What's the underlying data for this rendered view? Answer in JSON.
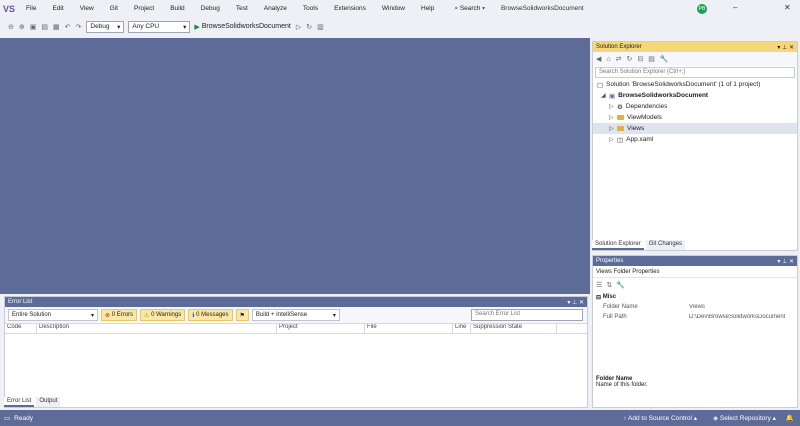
{
  "menubar": {
    "logo": "VS",
    "items": [
      "File",
      "Edit",
      "View",
      "Git",
      "Project",
      "Build",
      "Debug",
      "Test",
      "Analyze",
      "Tools",
      "Extensions",
      "Window",
      "Help"
    ],
    "search_label": "Search ▾",
    "solution_title": "BrowseSolidworksDocument",
    "avatar_initials": "PB",
    "minimize": "–",
    "close": "✕"
  },
  "toolbar": {
    "config": "Debug",
    "platform": "Any CPU",
    "run_target": "BrowseSolidworksDocument"
  },
  "error_list": {
    "title": "Error List",
    "scope": "Entire Solution",
    "errors": "0 Errors",
    "warnings": "0 Warnings",
    "messages": "0 Messages",
    "build_filter": "Build + IntelliSense",
    "search_placeholder": "Search Error List",
    "columns": [
      "Code",
      "Description",
      "Project",
      "File",
      "Line",
      "Suppression State"
    ]
  },
  "bottom_tabs": {
    "error_list": "Error List",
    "output": "Output"
  },
  "solution_explorer": {
    "title": "Solution Explorer",
    "search_placeholder": "Search Solution Explorer (Ctrl+;)",
    "solution": "Solution 'BrowseSolidworksDocument' (1 of 1 project)",
    "project": "BrowseSolidworksDocument",
    "nodes": [
      "Dependencies",
      "ViewModels",
      "Views",
      "App.xaml"
    ],
    "tabs": [
      "Solution Explorer",
      "Git Changes"
    ]
  },
  "properties": {
    "title": "Properties",
    "object": "Views Folder Properties",
    "section": "Misc",
    "rows": [
      {
        "key": "Folder Name",
        "value": "Views"
      },
      {
        "key": "Full Path",
        "value": "D:\\Dev\\BrowseSolidworksDocument"
      }
    ],
    "desc_title": "Folder Name",
    "desc_text": "Name of this folder."
  },
  "status": {
    "ready": "Ready",
    "source_control": "Add to Source Control",
    "repo": "Select Repository"
  }
}
